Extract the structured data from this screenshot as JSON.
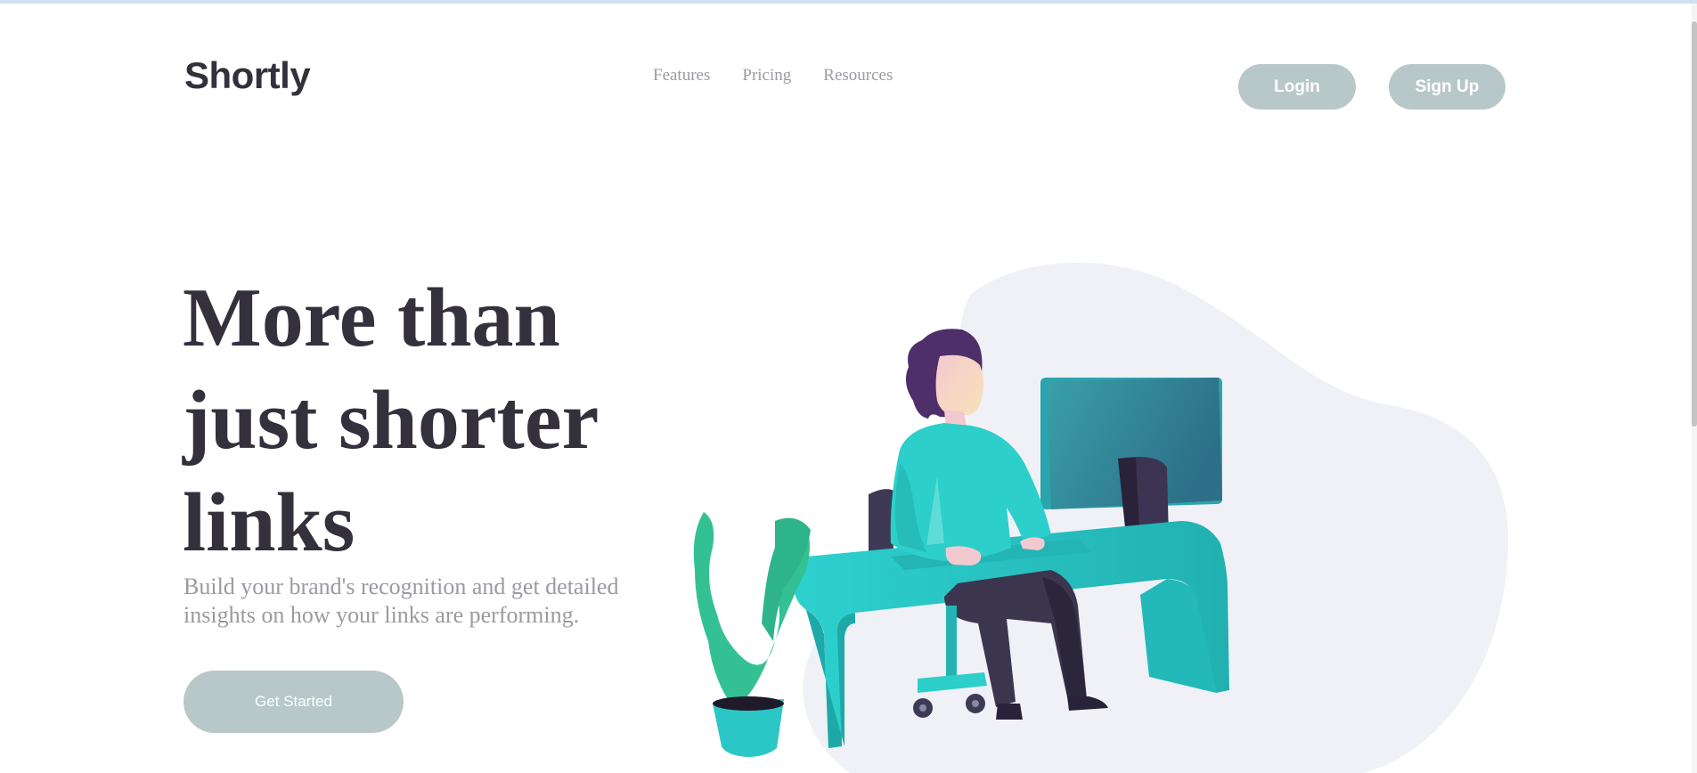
{
  "header": {
    "logo": "Shortly",
    "nav": [
      {
        "label": "Features"
      },
      {
        "label": "Pricing"
      },
      {
        "label": "Resources"
      }
    ],
    "login_label": "Login",
    "signup_label": "Sign Up"
  },
  "hero": {
    "title": "More than just shorter links",
    "subtitle": "Build your brand's recognition and get detailed insights on how your links are performing.",
    "cta_label": "Get Started"
  },
  "colors": {
    "text_dark": "#34313d",
    "text_gray": "#9a9aa3",
    "button_bg": "#b8c8c8",
    "accent_cyan": "#2acfcf",
    "blob_bg": "#eff1f7"
  },
  "illustration": {
    "subject": "person-working-at-desk",
    "icons": [
      "person-illustration",
      "desk-illustration",
      "monitor-illustration",
      "plant-illustration",
      "chair-illustration"
    ]
  }
}
